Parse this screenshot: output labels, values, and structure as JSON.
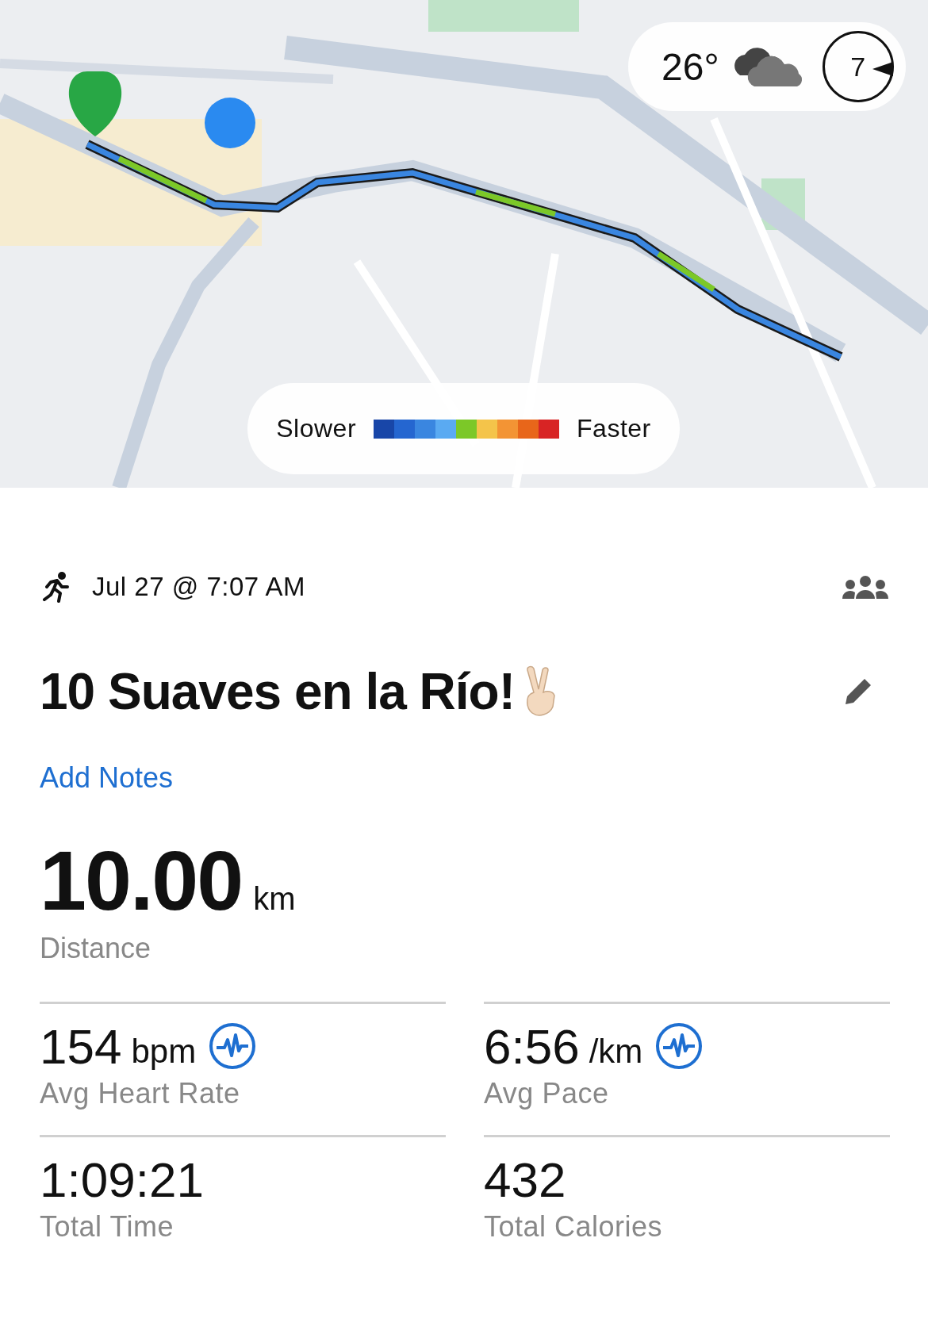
{
  "map": {
    "kind": "picture",
    "weather": {
      "temperature": "26°",
      "compass": "7"
    },
    "legend": {
      "low_label": "Slower",
      "high_label": "Faster",
      "swatches": [
        {
          "color": "#1846a8"
        },
        {
          "color": "#2566d0"
        },
        {
          "color": "#3a86e0"
        },
        {
          "color": "#5aaaf2"
        },
        {
          "color": "#7cc828"
        },
        {
          "color": "#f4c44a"
        },
        {
          "color": "#f39434"
        },
        {
          "color": "#e8661a"
        },
        {
          "color": "#d82424"
        }
      ]
    }
  },
  "activity": {
    "date": "Jul 27 @ 7:07 AM",
    "title": "10 Suaves en la Río!",
    "add_notes": "Add Notes"
  },
  "distance": {
    "value": "10.00",
    "unit": "km",
    "label": "Distance"
  },
  "stats": [
    {
      "value": "154",
      "unit": "bpm",
      "label": "Avg Heart Rate",
      "kind": "chart"
    },
    {
      "value": "6:56",
      "unit": "/km",
      "label": "Avg Pace",
      "kind": "chart"
    },
    {
      "value": "1:09:21",
      "label": "Total Time",
      "kind": "plain"
    },
    {
      "value": "432",
      "label": "Total Calories",
      "kind": "plain"
    }
  ]
}
